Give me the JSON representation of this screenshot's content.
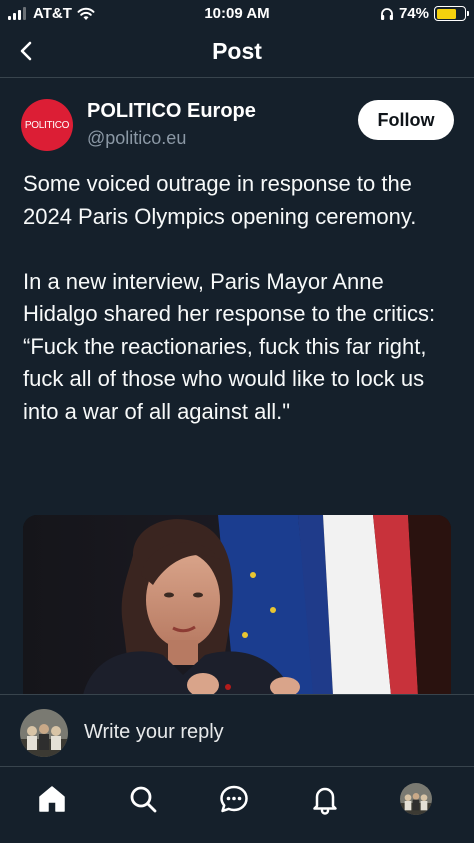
{
  "status_bar": {
    "carrier": "AT&T",
    "time": "10:09 AM",
    "battery": "74%",
    "battery_level": 0.74,
    "battery_color": "#f5d10d"
  },
  "header": {
    "title": "Post",
    "back_icon": "chevron-left-icon"
  },
  "post": {
    "author": {
      "name": "POLITICO Europe",
      "handle": "@politico.eu",
      "logo_text": "POLITICO",
      "logo_color": "#dc1e35"
    },
    "follow_label": "Follow",
    "text": "Some voiced outrage in response to the 2024 Paris Olympics opening ceremony.\n\nIn a new interview, Paris Mayor Anne Hidalgo shared her response to the critics: “Fuck the reactionaries, fuck this far right, fuck all of those who would like to lock us into a war of all against all.\""
  },
  "reply": {
    "placeholder": "Write your reply"
  },
  "tabs": [
    {
      "name": "home",
      "icon": "home-icon",
      "active": true
    },
    {
      "name": "search",
      "icon": "search-icon"
    },
    {
      "name": "messages",
      "icon": "chat-bubble-icon"
    },
    {
      "name": "notifications",
      "icon": "bell-icon"
    },
    {
      "name": "profile",
      "icon": "avatar"
    }
  ],
  "colors": {
    "background": "#15202b",
    "divider": "#38444d",
    "secondary_text": "#8b98a5"
  }
}
